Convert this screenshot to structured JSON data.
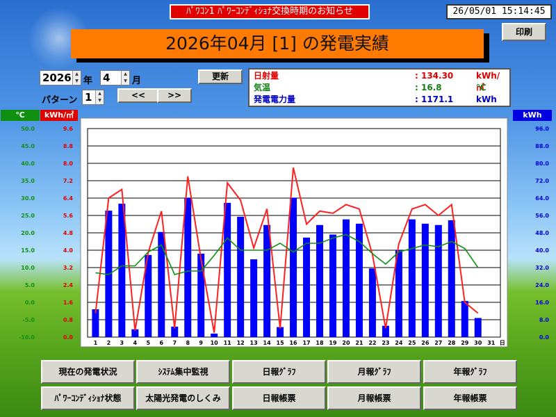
{
  "notice": "ﾊﾟﾜｺﾝ1 ﾊﾟﾜｰｺﾝﾃﾞｨｼｮﾅ交換時期のお知らせ",
  "clock": "26/05/01 15:14:45",
  "print_label": "印刷",
  "title": "2026年04月 [1] の発電実績",
  "controls": {
    "year": "2026",
    "year_unit": "年",
    "month": "4",
    "month_unit": "月",
    "update_label": "更新",
    "pattern_label": "パターン",
    "pattern": "1",
    "prev_label": "<<",
    "next_label": ">>"
  },
  "summary": [
    {
      "label": "日射量",
      "value": ": 134.30",
      "unit": "kWh/㎡",
      "color": "#e00000"
    },
    {
      "label": "気温",
      "value": ": 16.8",
      "unit": "℃",
      "color": "#108010"
    },
    {
      "label": "発電電力量",
      "value": ": 1171.1",
      "unit": "kWh",
      "color": "#0000c0"
    }
  ],
  "axis_headers": {
    "temp": "℃",
    "temp_color": "#109010",
    "irr": "kWh/㎡",
    "irr_color": "#e00000",
    "power": "kWh",
    "power_color": "#0000e0"
  },
  "chart_data": {
    "type": "bar",
    "x_suffix": "日",
    "categories": [
      "1",
      "2",
      "3",
      "4",
      "5",
      "6",
      "7",
      "8",
      "9",
      "10",
      "11",
      "12",
      "13",
      "14",
      "15",
      "16",
      "17",
      "18",
      "19",
      "20",
      "21",
      "22",
      "23",
      "24",
      "25",
      "26",
      "27",
      "28",
      "29",
      "30",
      "31"
    ],
    "series": [
      {
        "axis": "power",
        "type": "bar",
        "color": "#0000ff",
        "values": [
          12.8,
          58.2,
          61.4,
          3.6,
          37.8,
          48.4,
          4.8,
          64.2,
          38.4,
          1.6,
          61.8,
          55.4,
          35.8,
          51.6,
          4.6,
          64.2,
          45.8,
          51.6,
          47.2,
          54.2,
          52.2,
          31.6,
          5.2,
          40.2,
          54.2,
          52.2,
          51.6,
          53.8,
          16.6,
          8.8,
          0
        ]
      },
      {
        "axis": "irr",
        "type": "line",
        "color": "#ff2020",
        "values": [
          1.1,
          6.4,
          6.8,
          0.3,
          3.9,
          5.8,
          0.4,
          7.4,
          3.6,
          0.2,
          7.1,
          6.3,
          4.1,
          5.9,
          0.4,
          7.8,
          5.2,
          5.8,
          5.7,
          6.1,
          5.9,
          3.8,
          0.4,
          4.3,
          5.9,
          6.1,
          5.6,
          6.1,
          1.6,
          1.1
        ]
      },
      {
        "axis": "temp",
        "type": "line",
        "color": "#109010",
        "values": [
          8.5,
          8.0,
          10.5,
          10.5,
          14.5,
          16.5,
          8.0,
          9.0,
          9.0,
          13.5,
          18.5,
          15.0,
          15.0,
          15.0,
          17.0,
          14.5,
          17.0,
          17.0,
          18.5,
          19.5,
          17.5,
          14.0,
          11.0,
          14.5,
          15.5,
          16.5,
          16.0,
          17.5,
          15.5,
          10.0
        ]
      }
    ],
    "y_temp": {
      "ticks": [
        "50.0",
        "45.0",
        "40.0",
        "35.0",
        "30.0",
        "25.0",
        "20.0",
        "15.0",
        "10.0",
        "5.0",
        "0.0",
        "-5.0",
        "-10.0"
      ],
      "min": -10,
      "max": 50
    },
    "y_irr": {
      "ticks": [
        "9.6",
        "8.8",
        "8.0",
        "7.2",
        "6.4",
        "5.6",
        "4.8",
        "4.0",
        "3.2",
        "2.4",
        "1.6",
        "0.8",
        "0.0"
      ],
      "min": 0,
      "max": 9.6
    },
    "y_power": {
      "ticks": [
        "96.0",
        "88.0",
        "80.0",
        "72.0",
        "64.0",
        "56.0",
        "48.0",
        "40.0",
        "32.0",
        "24.0",
        "16.0",
        "8.0",
        "0.0"
      ],
      "min": 0,
      "max": 96
    }
  },
  "nav": {
    "row1": [
      "現在の発電状況",
      "ｼｽﾃﾑ集中監視",
      "日報ｸﾞﾗﾌ",
      "月報ｸﾞﾗﾌ",
      "年報ｸﾞﾗﾌ"
    ],
    "row2": [
      "ﾊﾟﾜｰｺﾝﾃﾞｨｼｮﾅ状態",
      "太陽光発電のしくみ",
      "日報帳票",
      "月報帳票",
      "年報帳票"
    ]
  }
}
